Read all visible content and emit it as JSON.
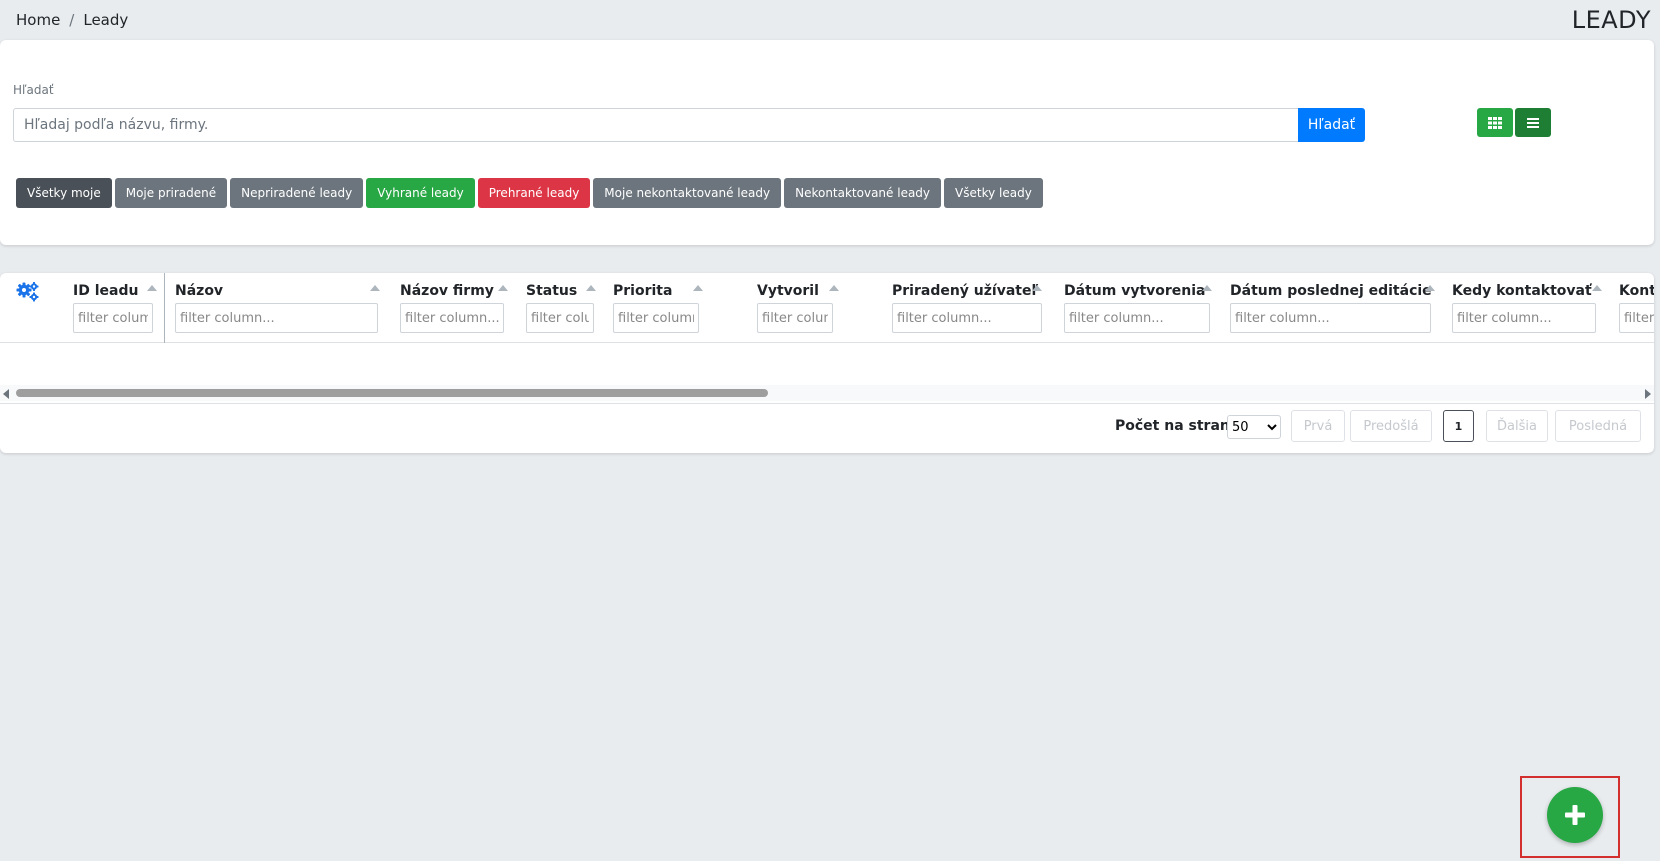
{
  "breadcrumb": {
    "home": "Home",
    "separator": "/",
    "current": "Leady"
  },
  "page_title": "LEADY",
  "search": {
    "label": "Hľadať",
    "placeholder": "Hľadaj podľa názvu, firmy.",
    "value": "",
    "button_label": "Hľadať"
  },
  "view_toggle": {
    "grid_icon": "grid-icon",
    "list_icon": "list-icon"
  },
  "filters": [
    {
      "label": "Všetky moje",
      "color": "#495057"
    },
    {
      "label": "Moje priradené",
      "color": "#6c757d"
    },
    {
      "label": "Nepriradené leady",
      "color": "#6c757d"
    },
    {
      "label": "Vyhrané leady",
      "color": "#28a745"
    },
    {
      "label": "Prehrané leady",
      "color": "#dc3545"
    },
    {
      "label": "Moje nekontaktované leady",
      "color": "#6c757d"
    },
    {
      "label": "Nekontaktované leady",
      "color": "#6c757d"
    },
    {
      "label": "Všetky leady",
      "color": "#6c757d"
    }
  ],
  "table": {
    "settings_icon": "gears-icon",
    "filter_placeholder": "filter column...",
    "columns": [
      {
        "title": "ID leadu"
      },
      {
        "title": "Názov"
      },
      {
        "title": "Názov firmy"
      },
      {
        "title": "Status"
      },
      {
        "title": "Priorita"
      },
      {
        "title": "Vytvoril"
      },
      {
        "title": "Priradený užívateľ"
      },
      {
        "title": "Dátum vytvorenia"
      },
      {
        "title": "Dátum poslednej editácie"
      },
      {
        "title": "Kedy kontaktovať"
      },
      {
        "title": "Kontakt"
      }
    ],
    "rows": []
  },
  "pagination": {
    "per_page_label": "Počet na stranu",
    "per_page_value": "50",
    "first": "Prvá",
    "prev": "Predošlá",
    "current": "1",
    "next": "Ďalšia",
    "last": "Posledná"
  },
  "fab": {
    "icon": "plus-icon",
    "color": "#28a745"
  }
}
